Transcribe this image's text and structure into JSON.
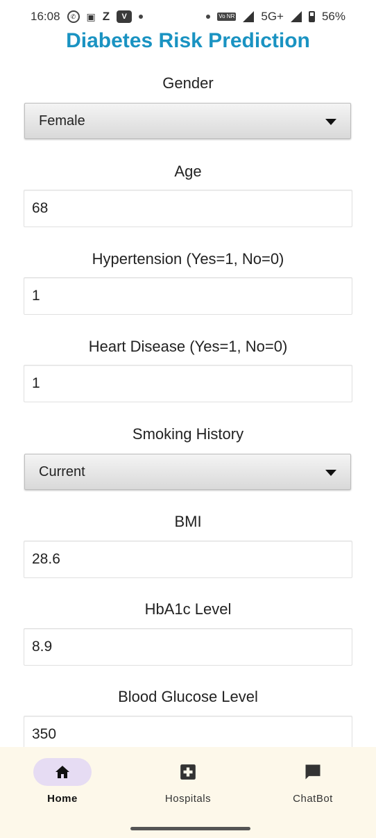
{
  "status_bar": {
    "time": "16:08",
    "network": "5G+",
    "battery": "56%",
    "z_icon_label": "Z",
    "v_icon_label": "V",
    "volte_label": "Vo NR"
  },
  "app": {
    "title": "Diabetes Risk Prediction"
  },
  "form": {
    "gender_label": "Gender",
    "gender_value": "Female",
    "age_label": "Age",
    "age_value": "68",
    "hypertension_label": "Hypertension (Yes=1, No=0)",
    "hypertension_value": "1",
    "heart_disease_label": "Heart Disease (Yes=1, No=0)",
    "heart_disease_value": "1",
    "smoking_label": "Smoking History",
    "smoking_value": "Current",
    "bmi_label": "BMI",
    "bmi_value": "28.6",
    "hba1c_label": "HbA1c Level",
    "hba1c_value": "8.9",
    "glucose_label": "Blood Glucose Level",
    "glucose_value": "350"
  },
  "nav": {
    "items": [
      {
        "label": "Home",
        "icon": "home-icon",
        "active": true
      },
      {
        "label": "Hospitals",
        "icon": "hospital-icon",
        "active": false
      },
      {
        "label": "ChatBot",
        "icon": "chat-icon",
        "active": false
      }
    ]
  },
  "colors": {
    "title": "#1a93c2",
    "nav_background": "#fdf8ea",
    "nav_active_pill": "#e6dcf3"
  }
}
